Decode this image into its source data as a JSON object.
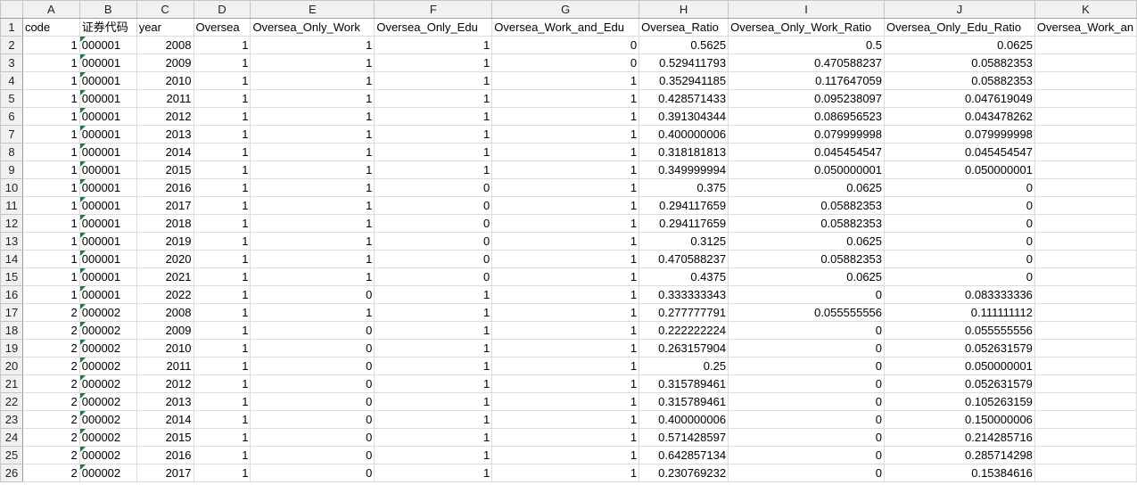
{
  "columns": [
    "A",
    "B",
    "C",
    "D",
    "E",
    "F",
    "G",
    "H",
    "I",
    "J",
    "K"
  ],
  "headers": [
    "code",
    "证券代码",
    "year",
    "Oversea",
    "Oversea_Only_Work",
    "Oversea_Only_Edu",
    "Oversea_Work_and_Edu",
    "Oversea_Ratio",
    "Oversea_Only_Work_Ratio",
    "Oversea_Only_Edu_Ratio",
    "Oversea_Work_an"
  ],
  "rows": [
    [
      "1",
      "000001",
      "2008",
      "1",
      "1",
      "1",
      "0",
      "0.5625",
      "0.5",
      "0.0625",
      ""
    ],
    [
      "1",
      "000001",
      "2009",
      "1",
      "1",
      "1",
      "0",
      "0.529411793",
      "0.470588237",
      "0.05882353",
      ""
    ],
    [
      "1",
      "000001",
      "2010",
      "1",
      "1",
      "1",
      "1",
      "0.352941185",
      "0.117647059",
      "0.05882353",
      ""
    ],
    [
      "1",
      "000001",
      "2011",
      "1",
      "1",
      "1",
      "1",
      "0.428571433",
      "0.095238097",
      "0.047619049",
      ""
    ],
    [
      "1",
      "000001",
      "2012",
      "1",
      "1",
      "1",
      "1",
      "0.391304344",
      "0.086956523",
      "0.043478262",
      ""
    ],
    [
      "1",
      "000001",
      "2013",
      "1",
      "1",
      "1",
      "1",
      "0.400000006",
      "0.079999998",
      "0.079999998",
      ""
    ],
    [
      "1",
      "000001",
      "2014",
      "1",
      "1",
      "1",
      "1",
      "0.318181813",
      "0.045454547",
      "0.045454547",
      ""
    ],
    [
      "1",
      "000001",
      "2015",
      "1",
      "1",
      "1",
      "1",
      "0.349999994",
      "0.050000001",
      "0.050000001",
      ""
    ],
    [
      "1",
      "000001",
      "2016",
      "1",
      "1",
      "0",
      "1",
      "0.375",
      "0.0625",
      "0",
      ""
    ],
    [
      "1",
      "000001",
      "2017",
      "1",
      "1",
      "0",
      "1",
      "0.294117659",
      "0.05882353",
      "0",
      ""
    ],
    [
      "1",
      "000001",
      "2018",
      "1",
      "1",
      "0",
      "1",
      "0.294117659",
      "0.05882353",
      "0",
      ""
    ],
    [
      "1",
      "000001",
      "2019",
      "1",
      "1",
      "0",
      "1",
      "0.3125",
      "0.0625",
      "0",
      ""
    ],
    [
      "1",
      "000001",
      "2020",
      "1",
      "1",
      "0",
      "1",
      "0.470588237",
      "0.05882353",
      "0",
      ""
    ],
    [
      "1",
      "000001",
      "2021",
      "1",
      "1",
      "0",
      "1",
      "0.4375",
      "0.0625",
      "0",
      ""
    ],
    [
      "1",
      "000001",
      "2022",
      "1",
      "0",
      "1",
      "1",
      "0.333333343",
      "0",
      "0.083333336",
      ""
    ],
    [
      "2",
      "000002",
      "2008",
      "1",
      "1",
      "1",
      "1",
      "0.277777791",
      "0.055555556",
      "0.111111112",
      ""
    ],
    [
      "2",
      "000002",
      "2009",
      "1",
      "0",
      "1",
      "1",
      "0.222222224",
      "0",
      "0.055555556",
      ""
    ],
    [
      "2",
      "000002",
      "2010",
      "1",
      "0",
      "1",
      "1",
      "0.263157904",
      "0",
      "0.052631579",
      ""
    ],
    [
      "2",
      "000002",
      "2011",
      "1",
      "0",
      "1",
      "1",
      "0.25",
      "0",
      "0.050000001",
      ""
    ],
    [
      "2",
      "000002",
      "2012",
      "1",
      "0",
      "1",
      "1",
      "0.315789461",
      "0",
      "0.052631579",
      ""
    ],
    [
      "2",
      "000002",
      "2013",
      "1",
      "0",
      "1",
      "1",
      "0.315789461",
      "0",
      "0.105263159",
      ""
    ],
    [
      "2",
      "000002",
      "2014",
      "1",
      "0",
      "1",
      "1",
      "0.400000006",
      "0",
      "0.150000006",
      ""
    ],
    [
      "2",
      "000002",
      "2015",
      "1",
      "0",
      "1",
      "1",
      "0.571428597",
      "0",
      "0.214285716",
      ""
    ],
    [
      "2",
      "000002",
      "2016",
      "1",
      "0",
      "1",
      "1",
      "0.642857134",
      "0",
      "0.285714298",
      ""
    ],
    [
      "2",
      "000002",
      "2017",
      "1",
      "0",
      "1",
      "1",
      "0.230769232",
      "0",
      "0.15384616",
      ""
    ]
  ]
}
